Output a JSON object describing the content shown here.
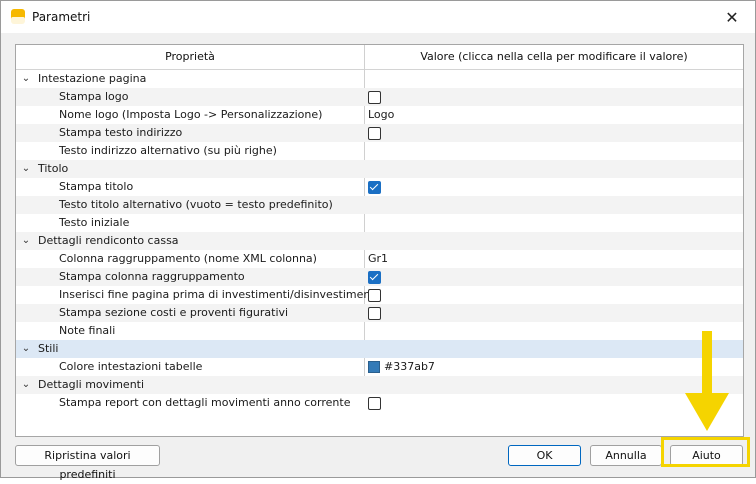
{
  "window": {
    "title": "Parametri",
    "app_icon": "banana-app-icon",
    "close_glyph": "✕"
  },
  "grid": {
    "headers": {
      "property": "Proprietà",
      "value": "Valore (clicca nella cella per modificare il valore)"
    },
    "rows": [
      {
        "kind": "group",
        "label": "Intestazione pagina",
        "value_type": "none",
        "value": ""
      },
      {
        "kind": "item",
        "label": "Stampa logo",
        "value_type": "checkbox",
        "checked": false
      },
      {
        "kind": "item",
        "label": "Nome logo (Imposta Logo -> Personalizzazione)",
        "value_type": "text",
        "value": "Logo"
      },
      {
        "kind": "item",
        "label": "Stampa testo indirizzo",
        "value_type": "checkbox",
        "checked": false
      },
      {
        "kind": "item",
        "label": "Testo indirizzo alternativo (su più righe)",
        "value_type": "text",
        "value": ""
      },
      {
        "kind": "group",
        "label": "Titolo",
        "value_type": "none",
        "value": ""
      },
      {
        "kind": "item",
        "label": "Stampa titolo",
        "value_type": "checkbox",
        "checked": true
      },
      {
        "kind": "item",
        "label": "Testo titolo alternativo (vuoto = testo predefinito)",
        "value_type": "text",
        "value": ""
      },
      {
        "kind": "item",
        "label": "Testo iniziale",
        "value_type": "text",
        "value": ""
      },
      {
        "kind": "group",
        "label": "Dettagli rendiconto cassa",
        "value_type": "none",
        "value": ""
      },
      {
        "kind": "item",
        "label": "Colonna raggruppamento (nome XML colonna)",
        "value_type": "text",
        "value": "Gr1"
      },
      {
        "kind": "item",
        "label": "Stampa colonna raggruppamento",
        "value_type": "checkbox",
        "checked": true
      },
      {
        "kind": "item",
        "label": "Inserisci fine pagina prima di investimenti/disinvestimenti",
        "value_type": "checkbox",
        "checked": false
      },
      {
        "kind": "item",
        "label": "Stampa sezione costi e proventi figurativi",
        "value_type": "checkbox",
        "checked": false
      },
      {
        "kind": "item",
        "label": "Note finali",
        "value_type": "text",
        "value": ""
      },
      {
        "kind": "group",
        "label": "Stili",
        "value_type": "none",
        "value": "",
        "selected": true
      },
      {
        "kind": "item",
        "label": "Colore intestazioni tabelle",
        "value_type": "color",
        "value": "#337ab7",
        "color": "#337ab7"
      },
      {
        "kind": "group",
        "label": "Dettagli movimenti",
        "value_type": "none",
        "value": ""
      },
      {
        "kind": "item",
        "label": "Stampa report con dettagli movimenti anno corrente",
        "value_type": "checkbox",
        "checked": false
      }
    ]
  },
  "buttons": {
    "reset": "Ripristina valori predefiniti",
    "ok": "OK",
    "cancel": "Annulla",
    "help": "Aiuto"
  },
  "annotation": {
    "highlight_color": "#f5d400",
    "arrow_color": "#f5d400"
  }
}
